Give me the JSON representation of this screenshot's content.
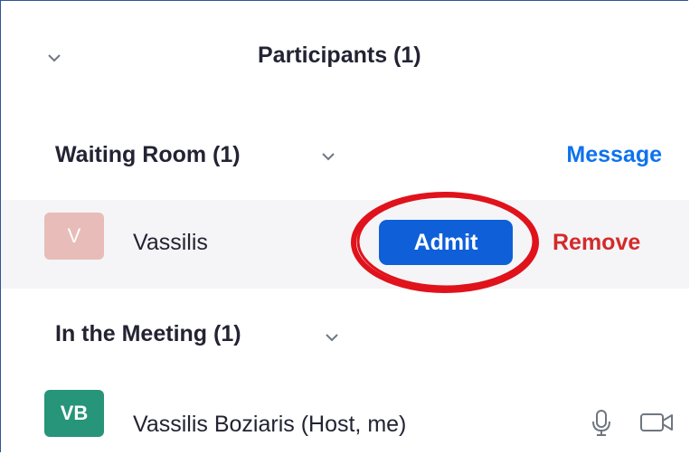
{
  "panel": {
    "title": "Participants (1)"
  },
  "waiting_room": {
    "title": "Waiting Room (1)",
    "message_label": "Message",
    "participants": [
      {
        "initial": "V",
        "name": "Vassilis",
        "admit_label": "Admit",
        "remove_label": "Remove"
      }
    ]
  },
  "in_meeting": {
    "title": "In the Meeting (1)",
    "participants": [
      {
        "initials": "VB",
        "name": "Vassilis Boziaris (Host, me)"
      }
    ]
  },
  "colors": {
    "accent_blue": "#0e72ed",
    "admit_button": "#0e5fd8",
    "remove_red": "#d42a2a",
    "annotation_ring": "#e0121b",
    "avatar_v": "#e8bcb8",
    "avatar_vb": "#26957a"
  },
  "icons": {
    "collapse": "chevron-down-icon",
    "section_toggle": "chevron-down-icon",
    "audio": "microphone-icon",
    "video": "video-camera-icon"
  }
}
